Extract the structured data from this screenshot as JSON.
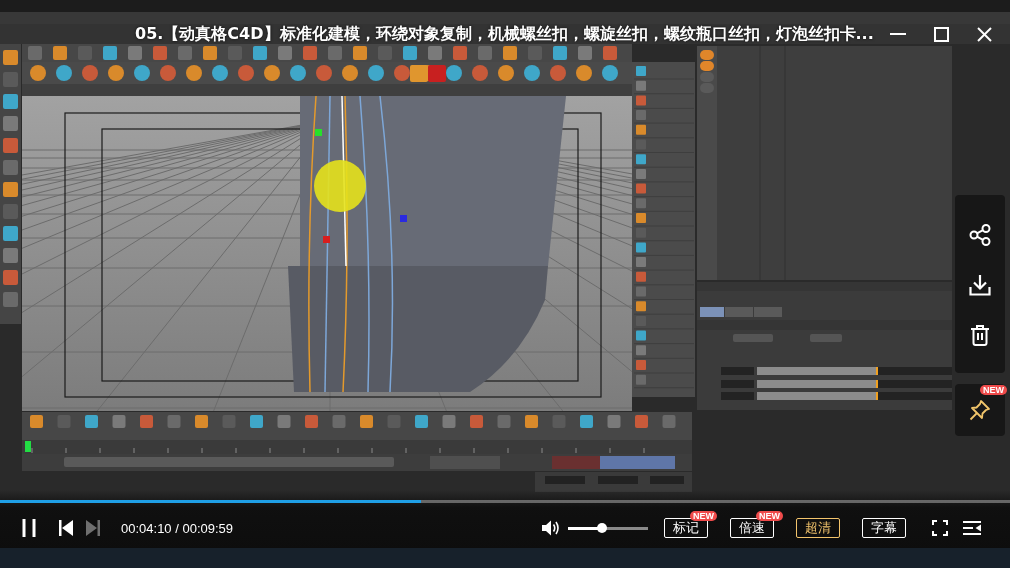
{
  "window": {
    "title": "05.【动真格C4D】标准化建模，环绕对象复制，机械螺丝扣，螺旋丝扣，螺纹瓶口丝扣，灯泡丝扣卡..."
  },
  "side_actions": [
    {
      "kind": "share"
    },
    {
      "kind": "download"
    },
    {
      "kind": "delete"
    }
  ],
  "pin": {
    "badge": "NEW"
  },
  "player": {
    "progress": {
      "level": 0.417
    },
    "playing": true,
    "previous": {
      "disabled": false
    },
    "next": {
      "disabled": true
    },
    "time": "00:04:10 / 00:09:59",
    "volume": {
      "level": 0.43
    },
    "buttons": [
      {
        "label": "标记",
        "badge": "NEW",
        "highlighted": false
      },
      {
        "label": "倍速",
        "badge": "NEW",
        "highlighted": false
      },
      {
        "label": "超清",
        "highlighted": true
      },
      {
        "label": "字幕",
        "highlighted": false
      }
    ]
  }
}
